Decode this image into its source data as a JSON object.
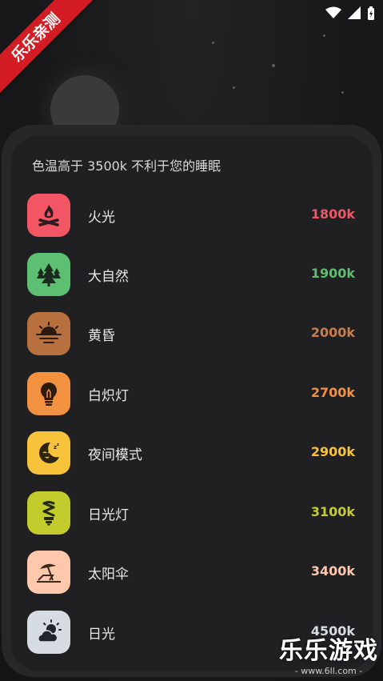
{
  "badge": "乐乐亲测",
  "header": {
    "title": "色温高于 3500k 不利于您的睡眠"
  },
  "items": [
    {
      "label": "火光",
      "value": "1800k",
      "color": "#f25563",
      "icon": "campfire-icon"
    },
    {
      "label": "大自然",
      "value": "1900k",
      "color": "#5cbf72",
      "icon": "pine-trees-icon"
    },
    {
      "label": "黄昏",
      "value": "2000k",
      "color": "#c97d4a",
      "icon": "sunset-icon"
    },
    {
      "label": "白炽灯",
      "value": "2700k",
      "color": "#f29140",
      "icon": "light-bulb-icon"
    },
    {
      "label": "夜间模式",
      "value": "2900k",
      "color": "#f6c33a",
      "icon": "moon-icon"
    },
    {
      "label": "日光灯",
      "value": "3100k",
      "color": "#c2cc2c",
      "icon": "cfl-bulb-icon"
    },
    {
      "label": "太阳伞",
      "value": "3400k",
      "color": "#ffc7ac",
      "icon": "beach-umbrella-icon"
    },
    {
      "label": "日光",
      "value": "4500k",
      "color": "#d7dce3",
      "icon": "sun-cloud-icon"
    }
  ],
  "watermark": {
    "title": "乐乐游戏",
    "url": "- www.6ll.com -"
  }
}
